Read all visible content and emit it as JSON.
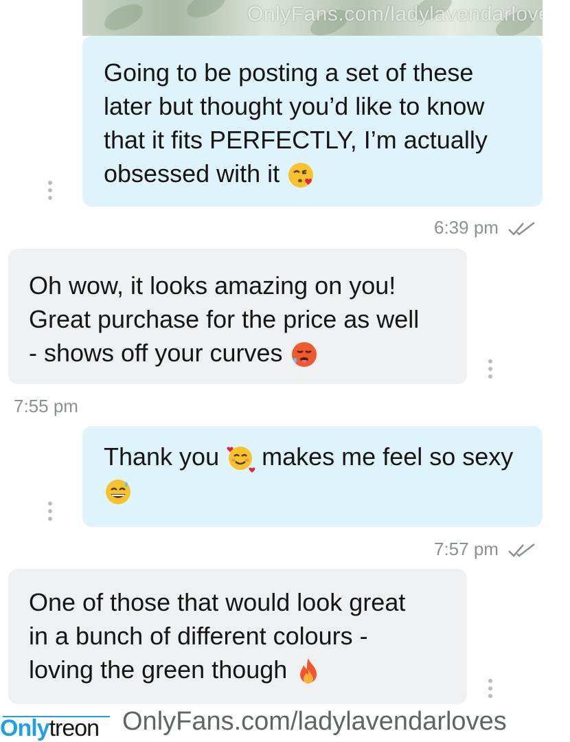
{
  "watermark": {
    "text": "OnlyFans.com/ladylavendarloves"
  },
  "messages": [
    {
      "text": "Going to be posting a set of these later but thought you’d like to know that it fits PERFECTLY, I’m actually obsessed with it",
      "emoji": "kissing-heart-emoji",
      "time": "6:39 pm",
      "direction": "outgoing"
    },
    {
      "text": "Oh wow, it looks amazing on you! Great purchase for the price as well - shows off your curves",
      "emoji": "hot-face-emoji",
      "time": "7:55 pm",
      "direction": "incoming"
    },
    {
      "text_a": "Thank you",
      "text_b": "makes me feel so sexy",
      "emoji_a": "smiling-hearts-emoji",
      "emoji_b": "sweat-smile-emoji",
      "time": "7:57 pm",
      "direction": "outgoing"
    },
    {
      "text": "One of those that would look great in a bunch of different colours - loving the green though",
      "emoji": "fire-emoji"
    }
  ],
  "footer": {
    "brand_only": "Only",
    "brand_treon": "treon",
    "url": "OnlyFans.com/ladylavendarloves"
  },
  "colors": {
    "outgoing_bubble": "#dff3fa",
    "incoming_bubble": "#eef0f1",
    "brand_blue": "#1fa0e0",
    "timestamp": "#8a9094"
  }
}
